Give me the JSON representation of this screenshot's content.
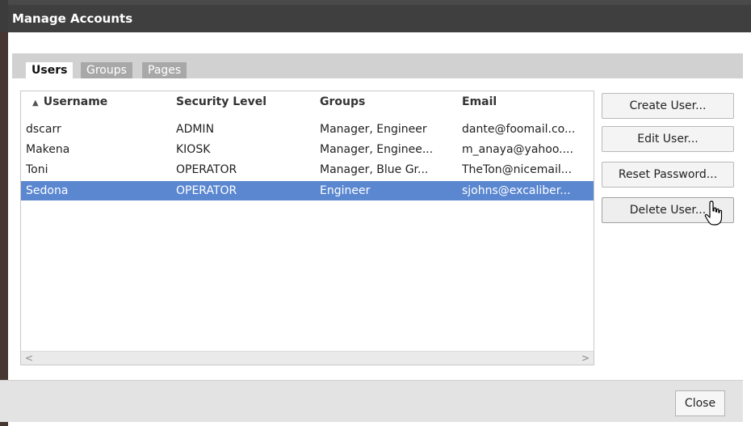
{
  "dialog": {
    "title": "Manage Accounts"
  },
  "tabs": [
    {
      "label": "Users",
      "active": true
    },
    {
      "label": "Groups",
      "active": false
    },
    {
      "label": "Pages",
      "active": false
    }
  ],
  "table": {
    "sort": {
      "column": "Username",
      "direction": "ascending",
      "icon": "sort-up-icon"
    },
    "columns": [
      "Username",
      "Security Level",
      "Groups",
      "Email"
    ],
    "rows": [
      {
        "username": "dscarr",
        "security_level": "ADMIN",
        "groups": "Manager, Engineer",
        "email": "dante@foomail.co...",
        "selected": false
      },
      {
        "username": "Makena",
        "security_level": "KIOSK",
        "groups": "Manager, Enginee...",
        "email": "m_anaya@yahoo....",
        "selected": false
      },
      {
        "username": "Toni",
        "security_level": "OPERATOR",
        "groups": "Manager, Blue Gr...",
        "email": "TheTon@nicemail...",
        "selected": false
      },
      {
        "username": "Sedona",
        "security_level": "OPERATOR",
        "groups": "Engineer",
        "email": "sjohns@excaliber...",
        "selected": true
      }
    ],
    "colors": {
      "selected_row": "#5b87d1",
      "selected_text": "#ffffff"
    }
  },
  "actions": {
    "create_user": "Create User...",
    "edit_user": "Edit User...",
    "reset_password": "Reset Password...",
    "delete_user": "Delete User..."
  },
  "footer": {
    "close": "Close"
  },
  "pointer": {
    "icon": "hand-pointer-icon",
    "hover_target": "Delete User..."
  }
}
